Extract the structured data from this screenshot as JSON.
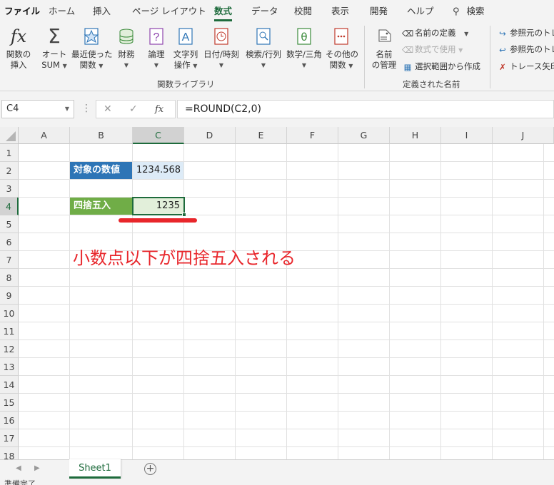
{
  "ribbon_tabs": [
    {
      "label": "ファイル"
    },
    {
      "label": "ホーム"
    },
    {
      "label": "挿入"
    },
    {
      "label": "ページ レイアウト"
    },
    {
      "label": "数式",
      "active": true
    },
    {
      "label": "データ"
    },
    {
      "label": "校閲"
    },
    {
      "label": "表示"
    },
    {
      "label": "開発"
    },
    {
      "label": "ヘルプ"
    },
    {
      "label": "検索"
    }
  ],
  "ribbon": {
    "function_library": {
      "insert_function": [
        "関数の",
        "挿入"
      ],
      "autosum": [
        "オート",
        "SUM"
      ],
      "recent": [
        "最近使った",
        "関数"
      ],
      "financial": "財務",
      "logical": "論理",
      "text": [
        "文字列",
        "操作"
      ],
      "datetime": "日付/時刻",
      "lookup": [
        "検索/行列"
      ],
      "math": [
        "数学/三角"
      ],
      "more": [
        "その他の",
        "関数"
      ],
      "group_label": "関数ライブラリ"
    },
    "defined_names": {
      "name_manager": [
        "名前",
        "の管理"
      ],
      "define_name": "名前の定義",
      "use_in_formula": "数式で使用",
      "create_from_selection": "選択範囲から作成",
      "group_label": "定義された名前"
    },
    "auditing": {
      "trace_precedents": "参照元のトレ",
      "trace_dependents": "参照先のトレ",
      "remove_arrows": "トレース矢印"
    }
  },
  "formula_bar": {
    "name_box": "C4",
    "formula": "=ROUND(C2,0)",
    "fx": "fx"
  },
  "columns": [
    "A",
    "B",
    "C",
    "D",
    "E",
    "F",
    "G",
    "H",
    "I",
    "J"
  ],
  "rows": [
    "1",
    "2",
    "3",
    "4",
    "5",
    "6",
    "7",
    "8",
    "9",
    "10",
    "11",
    "12",
    "13",
    "14",
    "15",
    "16",
    "17",
    "18"
  ],
  "cells": {
    "B2": "対象の数値",
    "C2": "1234.568",
    "B4": "四捨五入",
    "C4": "1235"
  },
  "annotation": "小数点以下が四捨五入される",
  "sheet_tab": "Sheet1",
  "status": "準備完了",
  "colors": {
    "accent": "#1e6b3c",
    "label_blue": "#2e75b6",
    "label_green": "#70ad47",
    "value_blue": "#ddebf7",
    "value_green": "#e2efda",
    "annotation_red": "#e8262b"
  }
}
